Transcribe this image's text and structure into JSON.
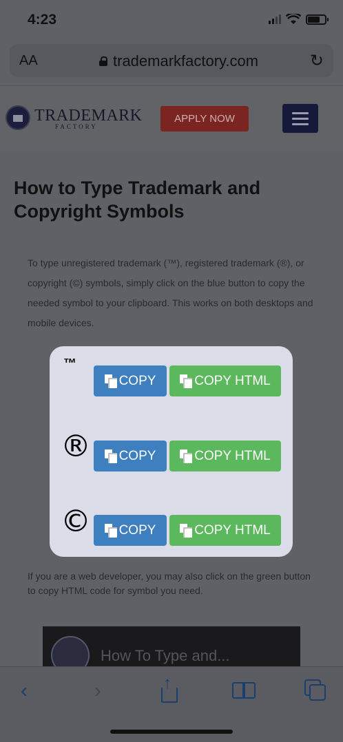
{
  "status": {
    "time": "4:23"
  },
  "browser": {
    "aa_label": "AA",
    "url": "trademarkfactory.com"
  },
  "site": {
    "logo_main": "TRADEMARK",
    "logo_sub": "FACTORY",
    "apply_label": "APPLY NOW"
  },
  "article": {
    "title": "How to Type Trademark and Copyright Symbols",
    "intro": "To type unregistered trademark (™), registered trademark (®), or copyright (©) symbols, simply click on the blue button to copy the needed symbol to your clipboard. This works on both desktops and mobile devices.",
    "dev_note": "If you are a web developer, you may also click on the green button to copy HTML code for symbol you need."
  },
  "popup": {
    "rows": [
      {
        "symbol": "™",
        "copy_label": "COPY",
        "html_label": "COPY HTML"
      },
      {
        "symbol": "®",
        "copy_label": "COPY",
        "html_label": "COPY HTML"
      },
      {
        "symbol": "©",
        "copy_label": "COPY",
        "html_label": "COPY HTML"
      }
    ]
  },
  "video": {
    "title": "How To Type and..."
  },
  "colors": {
    "copy_button": "#3d7fbf",
    "html_button": "#5cb85c",
    "popup_bg": "#dadde8"
  }
}
